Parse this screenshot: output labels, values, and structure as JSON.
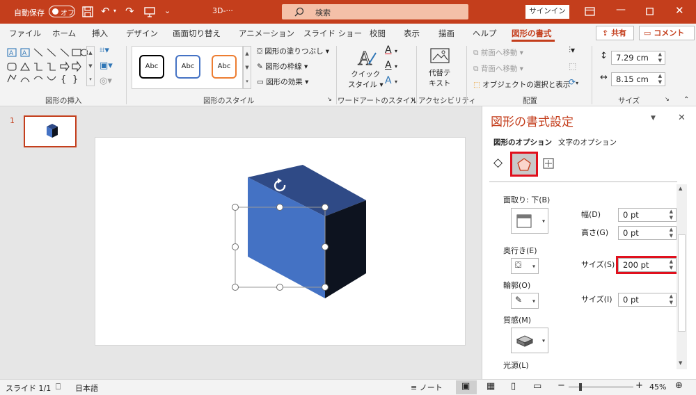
{
  "titlebar": {
    "autosave_label": "自動保存",
    "autosave_state": "オフ",
    "doc_title": "3D-···",
    "search_placeholder": "検索",
    "signin": "サインイン"
  },
  "tabs": [
    "ファイル",
    "ホーム",
    "挿入",
    "デザイン",
    "画面切り替え",
    "アニメーション",
    "スライド ショー",
    "校閲",
    "表示",
    "描画",
    "ヘルプ",
    "図形の書式"
  ],
  "share": "共有",
  "comment": "コメント",
  "ribbon": {
    "groups": {
      "insert_shapes": "図形の挿入",
      "shape_styles": "図形のスタイル",
      "wordart": "ワードアートのスタイル",
      "accessibility": "アクセシビリティ",
      "arrange": "配置",
      "size": "サイズ"
    },
    "style_sample": "Abc",
    "fill": "図形の塗りつぶし",
    "outline": "図形の枠線",
    "effect": "図形の効果",
    "quick_style_1": "クイック",
    "quick_style_2": "スタイル",
    "alt_text_1": "代替テ",
    "alt_text_2": "キスト",
    "bring_forward": "前面へ移動",
    "send_backward": "背面へ移動",
    "selection_pane": "オブジェクトの選択と表示",
    "height_value": "7.29 cm",
    "width_value": "8.15 cm"
  },
  "slides": {
    "number": "1"
  },
  "panel": {
    "title": "図形の書式設定",
    "tab_shape": "図形のオプション",
    "tab_text": "文字のオプション",
    "bevel_bottom": "面取り: 下(B)",
    "width_label": "幅(D)",
    "width_value": "0 pt",
    "height_label": "高さ(G)",
    "height_value": "0 pt",
    "depth_label": "奥行き(E)",
    "depth_size_label": "サイズ(S)",
    "depth_size_value": "200 pt",
    "contour_label": "輪郭(O)",
    "contour_size_label": "サイズ(I)",
    "contour_size_value": "0 pt",
    "material_label": "質感(M)",
    "lighting_label": "光源(L)"
  },
  "status": {
    "slide": "スライド 1/1",
    "language": "日本語",
    "notes": "ノート",
    "zoom": "45%"
  },
  "colors": {
    "accent": "#c43e1c",
    "highlight": "#e0101d",
    "cube_front": "#4472c4",
    "cube_top": "#2f4a86",
    "cube_side": "#0d131f"
  }
}
